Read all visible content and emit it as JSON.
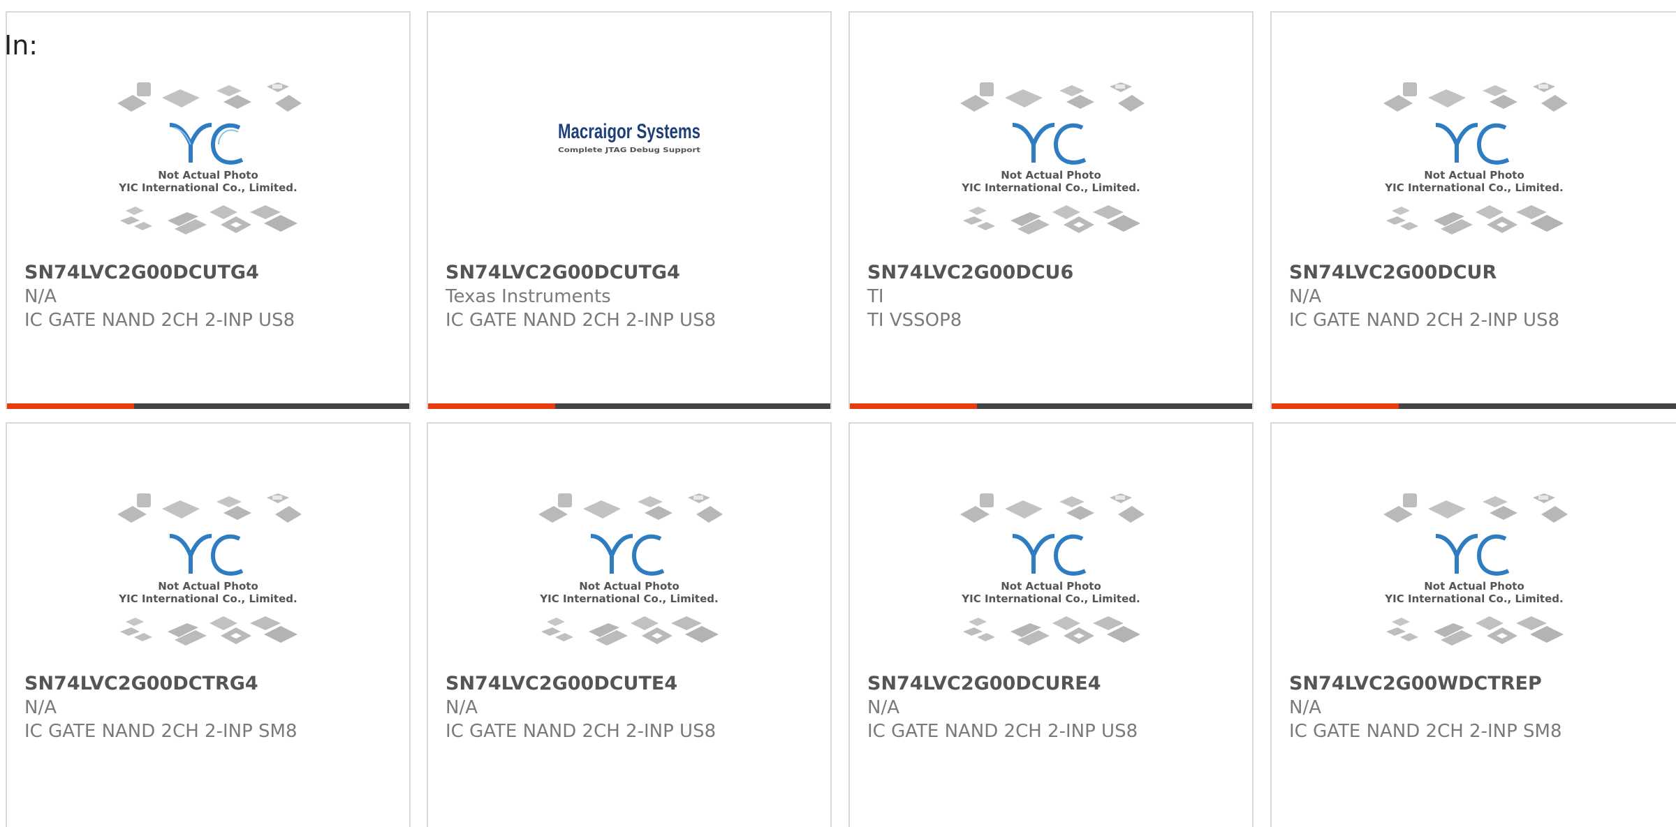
{
  "page": {
    "filter_label": "In:"
  },
  "brand": {
    "accent_color": "#e63d10",
    "bar_color": "#444444",
    "logo_text": "YIC",
    "placeholder_line1": "Not Actual Photo",
    "placeholder_line2": "YIC International Co., Limited.",
    "macraigor_title": "Macraigor Systems",
    "macraigor_tagline": "Complete JTAG Debug Support"
  },
  "products": [
    {
      "part_number": "SN74LVC2G00DCUTG4",
      "manufacturer": "N/A",
      "description": "IC GATE NAND 2CH 2-INP US8",
      "image": "yic-placeholder"
    },
    {
      "part_number": "SN74LVC2G00DCUTG4",
      "manufacturer": "Texas Instruments",
      "description": "IC GATE NAND 2CH 2-INP US8",
      "image": "macraigor-logo"
    },
    {
      "part_number": "SN74LVC2G00DCU6",
      "manufacturer": "TI",
      "description": "TI VSSOP8",
      "image": "yic-placeholder"
    },
    {
      "part_number": "SN74LVC2G00DCUR",
      "manufacturer": "N/A",
      "description": "IC GATE NAND 2CH 2-INP US8",
      "image": "yic-placeholder"
    },
    {
      "part_number": "SN74LVC2G00DCTRG4",
      "manufacturer": "N/A",
      "description": "IC GATE NAND 2CH 2-INP SM8",
      "image": "yic-placeholder"
    },
    {
      "part_number": "SN74LVC2G00DCUTE4",
      "manufacturer": "N/A",
      "description": "IC GATE NAND 2CH 2-INP US8",
      "image": "yic-placeholder"
    },
    {
      "part_number": "SN74LVC2G00DCURE4",
      "manufacturer": "N/A",
      "description": "IC GATE NAND 2CH 2-INP US8",
      "image": "yic-placeholder"
    },
    {
      "part_number": "SN74LVC2G00WDCTREP",
      "manufacturer": "N/A",
      "description": "IC GATE NAND 2CH 2-INP SM8",
      "image": "yic-placeholder"
    }
  ]
}
